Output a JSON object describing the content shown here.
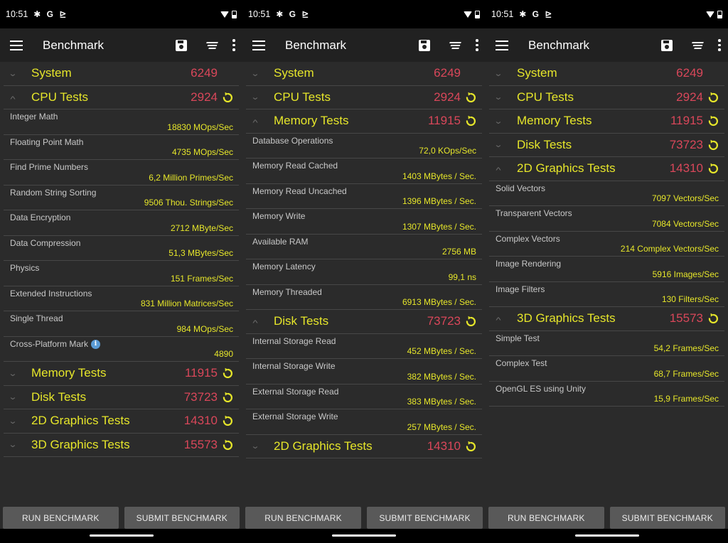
{
  "status": {
    "time": "10:51",
    "icons": [
      "settings-icon",
      "google-icon",
      "play-icon"
    ]
  },
  "app": {
    "title": "Benchmark"
  },
  "buttons": {
    "run": "RUN BENCHMARK",
    "submit": "SUBMIT BENCHMARK"
  },
  "colors": {
    "group_name": "#e6e62a",
    "score": "#d9475a",
    "value": "#e6e62a",
    "background": "#2b2b2b",
    "appbar": "#212121",
    "button": "#595959"
  },
  "screens": [
    {
      "rows": [
        {
          "type": "group",
          "name": "System",
          "score": "6249",
          "expanded": false,
          "reload": false
        },
        {
          "type": "group",
          "name": "CPU Tests",
          "score": "2924",
          "expanded": true,
          "reload": true
        },
        {
          "type": "test",
          "name": "Integer Math",
          "value": "18830 MOps/Sec"
        },
        {
          "type": "test",
          "name": "Floating Point Math",
          "value": "4735 MOps/Sec"
        },
        {
          "type": "test",
          "name": "Find Prime Numbers",
          "value": "6,2 Million Primes/Sec"
        },
        {
          "type": "test",
          "name": "Random String Sorting",
          "value": "9506 Thou. Strings/Sec"
        },
        {
          "type": "test",
          "name": "Data Encryption",
          "value": "2712 MByte/Sec"
        },
        {
          "type": "test",
          "name": "Data Compression",
          "value": "51,3 MBytes/Sec"
        },
        {
          "type": "test",
          "name": "Physics",
          "value": "151 Frames/Sec"
        },
        {
          "type": "test",
          "name": "Extended Instructions",
          "value": "831 Million Matrices/Sec"
        },
        {
          "type": "test",
          "name": "Single Thread",
          "value": "984 MOps/Sec"
        },
        {
          "type": "test",
          "name": "Cross-Platform Mark",
          "value": "4890",
          "info": true
        },
        {
          "type": "group",
          "name": "Memory Tests",
          "score": "11915",
          "expanded": false,
          "reload": true
        },
        {
          "type": "group",
          "name": "Disk Tests",
          "score": "73723",
          "expanded": false,
          "reload": true
        },
        {
          "type": "group",
          "name": "2D Graphics Tests",
          "score": "14310",
          "expanded": false,
          "reload": true
        },
        {
          "type": "group",
          "name": "3D Graphics Tests",
          "score": "15573",
          "expanded": false,
          "reload": true
        }
      ]
    },
    {
      "rows": [
        {
          "type": "group",
          "name": "System",
          "score": "6249",
          "expanded": false,
          "reload": false
        },
        {
          "type": "group",
          "name": "CPU Tests",
          "score": "2924",
          "expanded": false,
          "reload": true
        },
        {
          "type": "group",
          "name": "Memory Tests",
          "score": "11915",
          "expanded": true,
          "reload": true
        },
        {
          "type": "test",
          "name": "Database Operations",
          "value": "72,0 KOps/Sec"
        },
        {
          "type": "test",
          "name": "Memory Read Cached",
          "value": "1403 MBytes / Sec."
        },
        {
          "type": "test",
          "name": "Memory Read Uncached",
          "value": "1396 MBytes / Sec."
        },
        {
          "type": "test",
          "name": "Memory Write",
          "value": "1307 MBytes / Sec."
        },
        {
          "type": "test",
          "name": "Available RAM",
          "value": "2756 MB"
        },
        {
          "type": "test",
          "name": "Memory Latency",
          "value": "99,1 ns"
        },
        {
          "type": "test",
          "name": "Memory Threaded",
          "value": "6913 MBytes / Sec."
        },
        {
          "type": "group",
          "name": "Disk Tests",
          "score": "73723",
          "expanded": true,
          "reload": true
        },
        {
          "type": "test",
          "name": "Internal Storage Read",
          "value": "452 MBytes / Sec."
        },
        {
          "type": "test",
          "name": "Internal Storage Write",
          "value": "382 MBytes / Sec."
        },
        {
          "type": "test",
          "name": "External Storage Read",
          "value": "383 MBytes / Sec."
        },
        {
          "type": "test",
          "name": "External Storage Write",
          "value": "257 MBytes / Sec."
        },
        {
          "type": "group",
          "name": "2D Graphics Tests",
          "score": "14310",
          "expanded": false,
          "reload": true
        }
      ]
    },
    {
      "rows": [
        {
          "type": "group",
          "name": "System",
          "score": "6249",
          "expanded": false,
          "reload": false
        },
        {
          "type": "group",
          "name": "CPU Tests",
          "score": "2924",
          "expanded": false,
          "reload": true
        },
        {
          "type": "group",
          "name": "Memory Tests",
          "score": "11915",
          "expanded": false,
          "reload": true
        },
        {
          "type": "group",
          "name": "Disk Tests",
          "score": "73723",
          "expanded": false,
          "reload": true
        },
        {
          "type": "group",
          "name": "2D Graphics Tests",
          "score": "14310",
          "expanded": true,
          "reload": true
        },
        {
          "type": "test",
          "name": "Solid Vectors",
          "value": "7097 Vectors/Sec"
        },
        {
          "type": "test",
          "name": "Transparent Vectors",
          "value": "7084 Vectors/Sec"
        },
        {
          "type": "test",
          "name": "Complex Vectors",
          "value": "214 Complex Vectors/Sec"
        },
        {
          "type": "test",
          "name": "Image Rendering",
          "value": "5916 Images/Sec"
        },
        {
          "type": "test",
          "name": "Image Filters",
          "value": "130 Filters/Sec"
        },
        {
          "type": "group",
          "name": "3D Graphics Tests",
          "score": "15573",
          "expanded": true,
          "reload": true
        },
        {
          "type": "test",
          "name": "Simple Test",
          "value": "54,2 Frames/Sec"
        },
        {
          "type": "test",
          "name": "Complex Test",
          "value": "68,7 Frames/Sec"
        },
        {
          "type": "test",
          "name": "OpenGL ES using Unity",
          "value": "15,9 Frames/Sec"
        }
      ]
    }
  ]
}
